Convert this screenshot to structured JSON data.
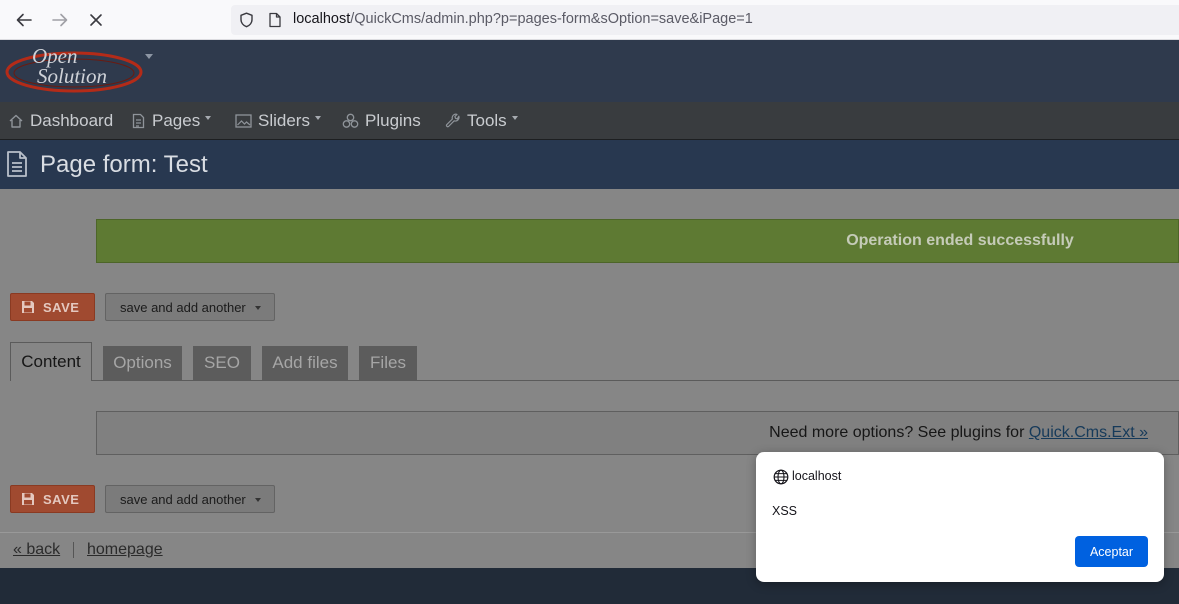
{
  "browser": {
    "url_host": "localhost",
    "url_path": "/QuickCms/admin.php?p=pages-form&sOption=save&iPage=1",
    "icons": [
      "back-icon",
      "forward-icon",
      "stop-icon",
      "shield-icon",
      "page-icon"
    ]
  },
  "header": {
    "logo_line1": "Open",
    "logo_line2": "Solution"
  },
  "menu": {
    "items": [
      {
        "label": "Dashboard",
        "icon": "home-icon"
      },
      {
        "label": "Pages",
        "icon": "document-icon",
        "dropdown": true
      },
      {
        "label": "Sliders",
        "icon": "image-icon",
        "dropdown": true
      },
      {
        "label": "Plugins",
        "icon": "puzzle-icon"
      },
      {
        "label": "Tools",
        "icon": "wrench-icon",
        "dropdown": true
      }
    ]
  },
  "page": {
    "title": "Page form: Test",
    "success_message": "Operation ended successfully",
    "save_label": "SAVE",
    "save_another_label": "save and add another",
    "tabs": [
      {
        "label": "Content",
        "active": true
      },
      {
        "label": "Options"
      },
      {
        "label": "SEO"
      },
      {
        "label": "Add files"
      },
      {
        "label": "Files"
      }
    ],
    "notice_text": "Need more options? See plugins for ",
    "notice_link": "Quick.Cms.Ext »",
    "back_link": "« back",
    "homepage_link": "homepage"
  },
  "dialog": {
    "origin": "localhost",
    "message": "XSS",
    "ok_label": "Aceptar"
  },
  "colors": {
    "header_bg": "#2f3a4d",
    "menu_bg": "#393c3f",
    "title_bg": "#283850",
    "success_bg": "#5e7a33",
    "save_btn": "#a04a30",
    "dialog_button": "#0061e0"
  }
}
